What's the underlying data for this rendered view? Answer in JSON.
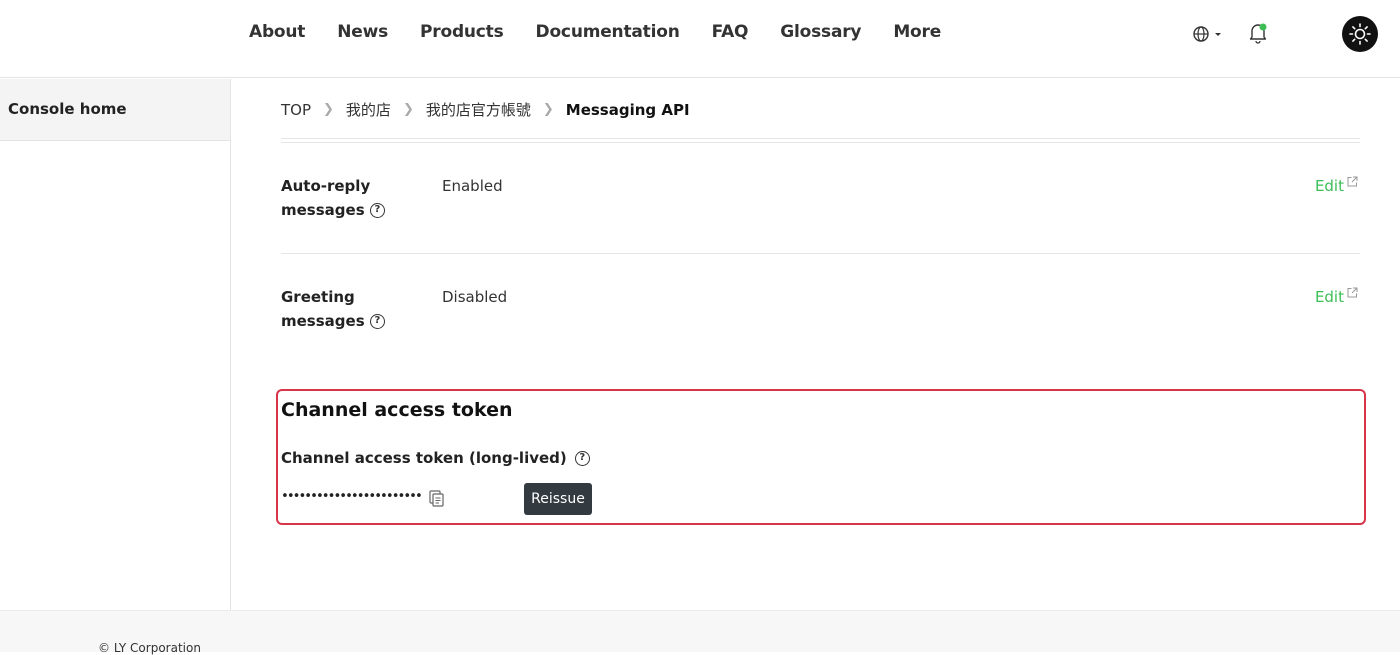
{
  "header": {
    "nav": [
      "About",
      "News",
      "Products",
      "Documentation",
      "FAQ",
      "Glossary",
      "More"
    ],
    "icons": {
      "language": "globe-icon",
      "notifications": "bell-icon",
      "theme": "sun-icon"
    },
    "notification_dot_color": "#3cbe55"
  },
  "sidebar": {
    "console_home": "Console home"
  },
  "breadcrumb": [
    "TOP",
    "我的店",
    "我的店官方帳號",
    "Messaging API"
  ],
  "settings": {
    "auto_reply": {
      "label": "Auto-reply messages",
      "value": "Enabled",
      "edit": "Edit"
    },
    "greeting": {
      "label": "Greeting messages",
      "value": "Disabled",
      "edit": "Edit"
    }
  },
  "token": {
    "title": "Channel access token",
    "subtitle": "Channel access token (long-lived)",
    "masked": "••••••••••••••••••••••••",
    "reissue": "Reissue",
    "highlight_color": "#d8344a"
  },
  "footer": {
    "copyright": "© LY Corporation"
  },
  "colors": {
    "accent": "#3cbe55",
    "dark_button": "#333a40"
  }
}
